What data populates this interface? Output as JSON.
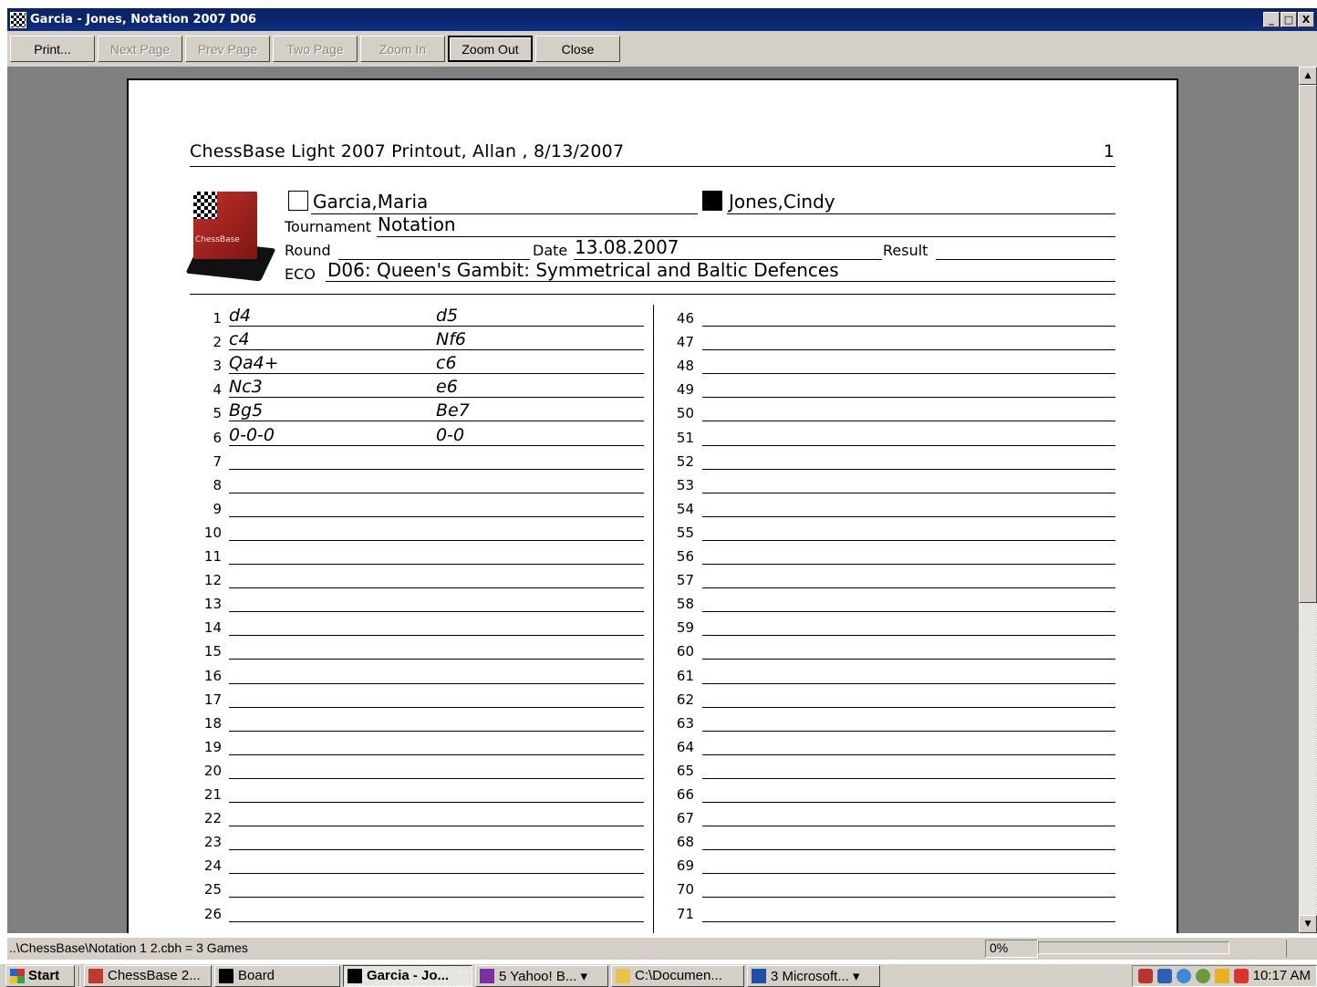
{
  "window": {
    "title": "Garcia - Jones, Notation 2007  D06",
    "buttons": [
      "_",
      "□",
      "X"
    ]
  },
  "toolbar": [
    {
      "label": "Print...",
      "state": "enabled"
    },
    {
      "label": "Next Page",
      "state": "disabled"
    },
    {
      "label": "Prev Page",
      "state": "disabled"
    },
    {
      "label": "Two Page",
      "state": "disabled"
    },
    {
      "label": "Zoom In",
      "state": "disabled"
    },
    {
      "label": "Zoom Out",
      "state": "active"
    },
    {
      "label": "Close",
      "state": "enabled"
    }
  ],
  "page": {
    "header_title": "ChessBase Light 2007 Printout, Allan , 8/13/2007",
    "page_number": "1",
    "logo_text": "ChessBase",
    "white_player": "Garcia,Maria",
    "black_player": "Jones,Cindy",
    "tournament_label": "Tournament",
    "tournament": "Notation",
    "round_label": "Round",
    "round": "",
    "date_label": "Date",
    "date": "13.08.2007",
    "result_label": "Result",
    "result": "",
    "eco_label": "ECO",
    "eco": "D06: Queen's Gambit: Symmetrical and Baltic Defences",
    "moves": [
      {
        "n": "1",
        "white": "d4",
        "black": "d5"
      },
      {
        "n": "2",
        "white": "c4",
        "black": "Nf6"
      },
      {
        "n": "3",
        "white": "Qa4+",
        "black": "c6"
      },
      {
        "n": "4",
        "white": "Nc3",
        "black": "e6"
      },
      {
        "n": "5",
        "white": "Bg5",
        "black": "Be7"
      },
      {
        "n": "6",
        "white": "0-0-0",
        "black": "0-0"
      }
    ],
    "left_numbers": [
      "1",
      "2",
      "3",
      "4",
      "5",
      "6",
      "7",
      "8",
      "9",
      "10",
      "11",
      "12",
      "13",
      "14",
      "15",
      "16",
      "17",
      "18",
      "19",
      "20",
      "21",
      "22",
      "23",
      "24",
      "25",
      "26"
    ],
    "right_numbers": [
      "46",
      "47",
      "48",
      "49",
      "50",
      "51",
      "52",
      "53",
      "54",
      "55",
      "56",
      "57",
      "58",
      "59",
      "60",
      "61",
      "62",
      "63",
      "64",
      "65",
      "66",
      "67",
      "68",
      "69",
      "70",
      "71"
    ]
  },
  "status": {
    "text": "..\\ChessBase\\Notation 1 2.cbh = 3 Games",
    "progress": "0%"
  },
  "taskbar": {
    "start": "Start",
    "tasks": [
      {
        "label": "ChessBase 2...",
        "active": false,
        "width": 140,
        "color": "#c0392b"
      },
      {
        "label": "Board",
        "active": false,
        "width": 138,
        "color": "#000000"
      },
      {
        "label": "Garcia - Jo...",
        "active": true,
        "width": 142,
        "color": "#000000"
      },
      {
        "label": "5 Yahoo! B... ▾",
        "active": false,
        "width": 146,
        "color": "#7b2fa0"
      },
      {
        "label": "C:\\Documen...",
        "active": false,
        "width": 146,
        "color": "#e8c34a"
      },
      {
        "label": "3 Microsoft... ▾",
        "active": false,
        "width": 146,
        "color": "#1c4fa8"
      }
    ],
    "clock": "10:17 AM"
  }
}
